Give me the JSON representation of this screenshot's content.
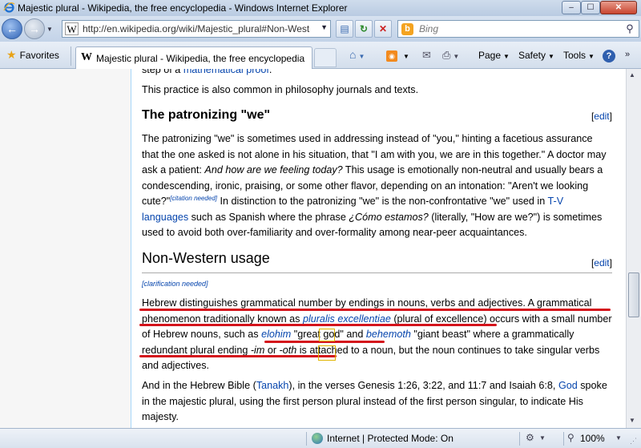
{
  "window": {
    "title": "Majestic plural - Wikipedia, the free encyclopedia - Windows Internet Explorer",
    "min_glyph": "–",
    "max_glyph": "☐",
    "close_glyph": "✕"
  },
  "navbar": {
    "url": "http://en.wikipedia.org/wiki/Majestic_plural#Non-West",
    "search_placeholder": "Bing"
  },
  "favorites_bar": {
    "favorites_label": "Favorites",
    "tab_title": "Majestic plural - Wikipedia, the free encyclopedia",
    "page_menu": "Page",
    "safety_menu": "Safety",
    "tools_menu": "Tools"
  },
  "article": {
    "top_fragment_link": "mathematical proof",
    "top_fragment_prefix": "step of a",
    "p_philosophy": "This practice is also common in philosophy journals and texts.",
    "section1": {
      "heading": "The patronizing \"we\"",
      "edit": "edit"
    },
    "p_patronizing": {
      "t1": "The patronizing \"we\" is sometimes used in addressing instead of \"you,\" hinting a facetious assurance that the one asked is not alone in his situation, that \"I am with you, we are in this together.\" A doctor may ask a patient: ",
      "i1": "And how are we feeling today?",
      "t2": " This usage is emotionally non-neutral and usually bears a condescending, ironic, praising, or some other flavor, depending on an intonation: \"Aren't we looking cute?\"",
      "cite": "[citation needed]",
      "t3": " In distinction to the patronizing \"we\" is the non-confrontative \"we\" used in ",
      "link_tv": "T-V languages",
      "t4": " such as Spanish where the phrase ",
      "i2": "¿Cómo estamos?",
      "t5": " (literally, \"How are we?\") is sometimes used to avoid both over-familiarity and over-formality among near-peer acquaintances."
    },
    "section2": {
      "heading": "Non-Western usage",
      "edit": "edit"
    },
    "clarification": "[clarification needed]",
    "p_hebrew": {
      "t1": "Hebrew distinguishes grammatical number by endings in nouns, verbs and adjectives. A grammatical phenomenon traditionally known as ",
      "link_pluralis": "pluralis excellentiae",
      "t2": " (plural of excellence) occurs with a small number of Hebrew nouns, such as ",
      "link_elohim": "elohim",
      "t3": " \"great god\" and ",
      "link_behemoth": "behemoth",
      "t4": " \"giant beast\" where a grammatically redundant plural ending ",
      "i_im": "-im",
      "t5": " or ",
      "i_oth": "-oth",
      "t6": " is attached to a noun, but the noun continues to take singular verbs and adjectives."
    },
    "p_bible": {
      "t1": "And in the Hebrew Bible (",
      "link_tanakh": "Tanakh",
      "t2": "), in the verses Genesis 1:26, 3:22, and 11:7 and Isaiah 6:8, ",
      "link_god": "God",
      "t3": " spoke in the majestic plural, using the first person plural instead of the first person singular, to indicate His majesty."
    }
  },
  "statusbar": {
    "zone": "Internet | Protected Mode: On",
    "zoom": "100%"
  },
  "colors": {
    "link": "#0645ad",
    "annotation_red": "#d4141c",
    "annotation_yellow": "#e0b400"
  }
}
